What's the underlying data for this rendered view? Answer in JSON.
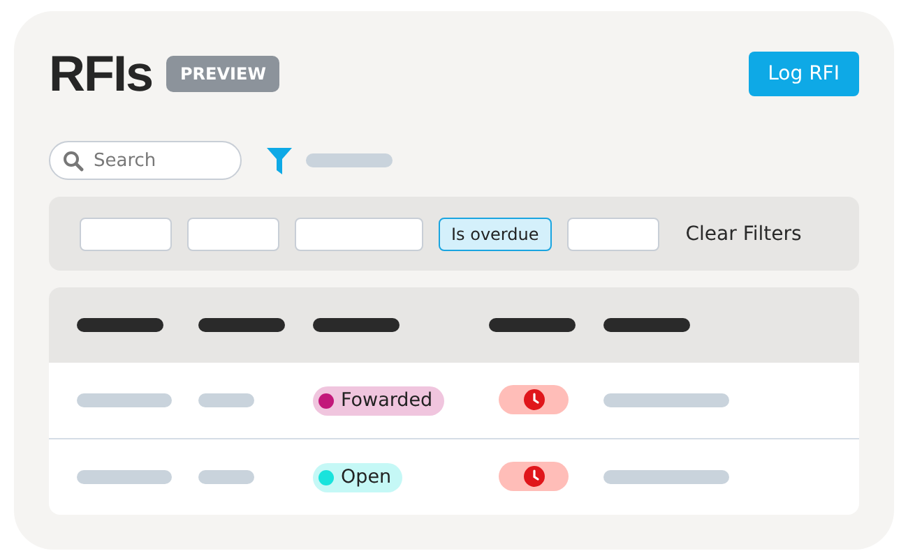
{
  "title": "RFIs",
  "badge": "PREVIEW",
  "primary_button": "Log RFI",
  "search": {
    "placeholder": "Search"
  },
  "filters": [
    {
      "selected": false
    },
    {
      "selected": false
    },
    {
      "selected": false
    },
    {
      "label": "Is overdue",
      "selected": true
    },
    {
      "selected": false
    }
  ],
  "clear_filters": "Clear Filters",
  "rows": [
    {
      "status": {
        "label": "Fowarded",
        "color": "#c2187a"
      },
      "overdue": true
    },
    {
      "status": {
        "label": "Open",
        "color": "#19e3dc"
      },
      "overdue": true
    }
  ]
}
